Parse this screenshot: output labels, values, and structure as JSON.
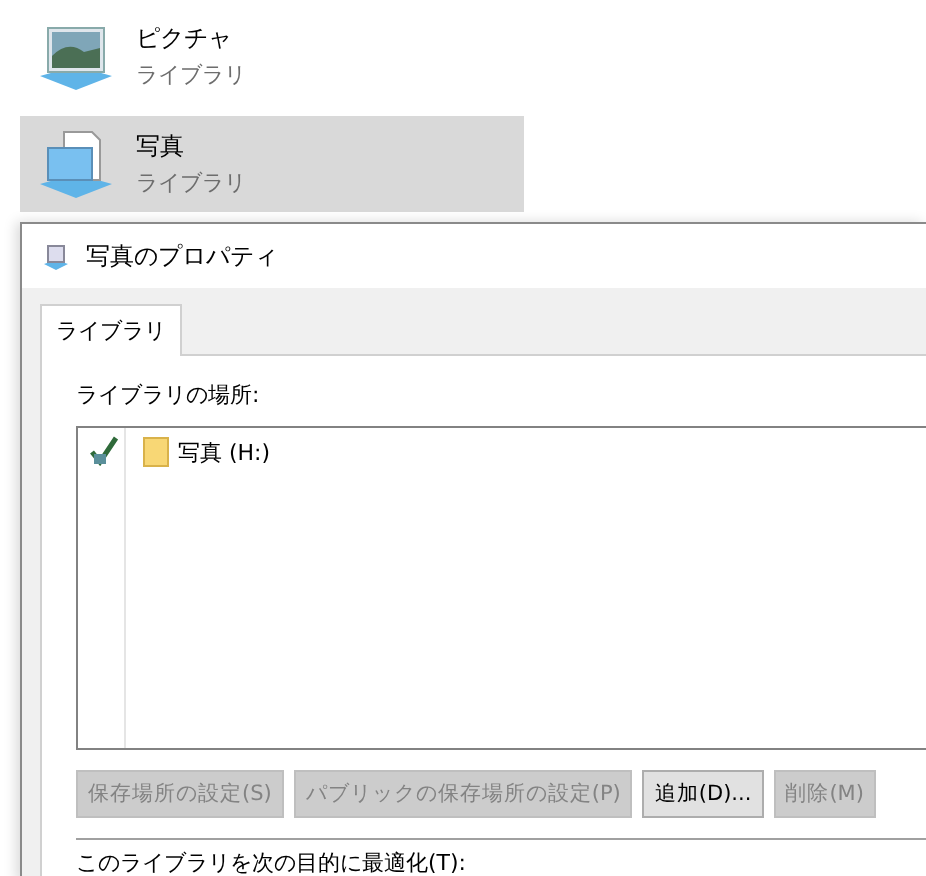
{
  "library_list": [
    {
      "name": "ピクチャ",
      "type": "ライブラリ",
      "kind": "pictures",
      "selected": false
    },
    {
      "name": "写真",
      "type": "ライブラリ",
      "kind": "documents",
      "selected": true
    }
  ],
  "dialog": {
    "title": "写真のプロパティ",
    "tabs": [
      {
        "label": "ライブラリ",
        "selected": true
      }
    ],
    "locations_label": "ライブラリの場所:",
    "locations": [
      {
        "name": "写真 (H:)",
        "default_save": true
      }
    ],
    "buttons": [
      {
        "label": "保存場所の設定(S)",
        "disabled": true
      },
      {
        "label": "パブリックの保存場所の設定(P)",
        "disabled": true
      },
      {
        "label": "追加(D)...",
        "disabled": false
      },
      {
        "label": "削除(M)",
        "disabled": true
      }
    ],
    "optimize_label": "このライブラリを次の目的に最適化(T):"
  }
}
